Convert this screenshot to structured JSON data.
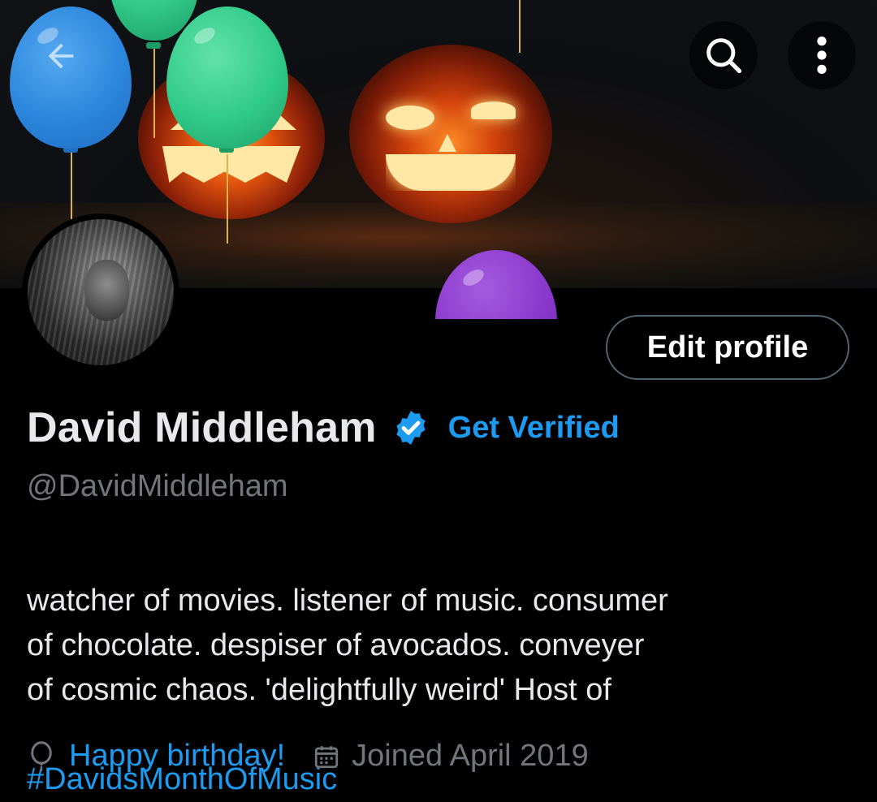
{
  "header": {
    "back_icon": "arrow-left-icon",
    "search_icon": "search-icon",
    "more_icon": "more-vertical-icon"
  },
  "profile": {
    "display_name": "David Middleham",
    "verified_badge_icon": "verified-badge-icon",
    "get_verified_label": "Get Verified",
    "handle": "@DavidMiddleham",
    "edit_profile_label": "Edit profile",
    "bio_text": "watcher of movies. listener of music. consumer\nof chocolate. despiser of avocados. conveyer\nof cosmic chaos.  'delightfully weird'  Host of",
    "bio_hashtag": "#DavidsMonthOfMusic",
    "birthday_icon": "balloon-icon",
    "birthday_label": "Happy birthday!",
    "joined_icon": "calendar-icon",
    "joined_label": "Joined April 2019"
  },
  "colors": {
    "accent": "#1d9bf0",
    "secondary_text": "#71767b",
    "primary_text": "#e7e9ea",
    "background": "#000000"
  }
}
